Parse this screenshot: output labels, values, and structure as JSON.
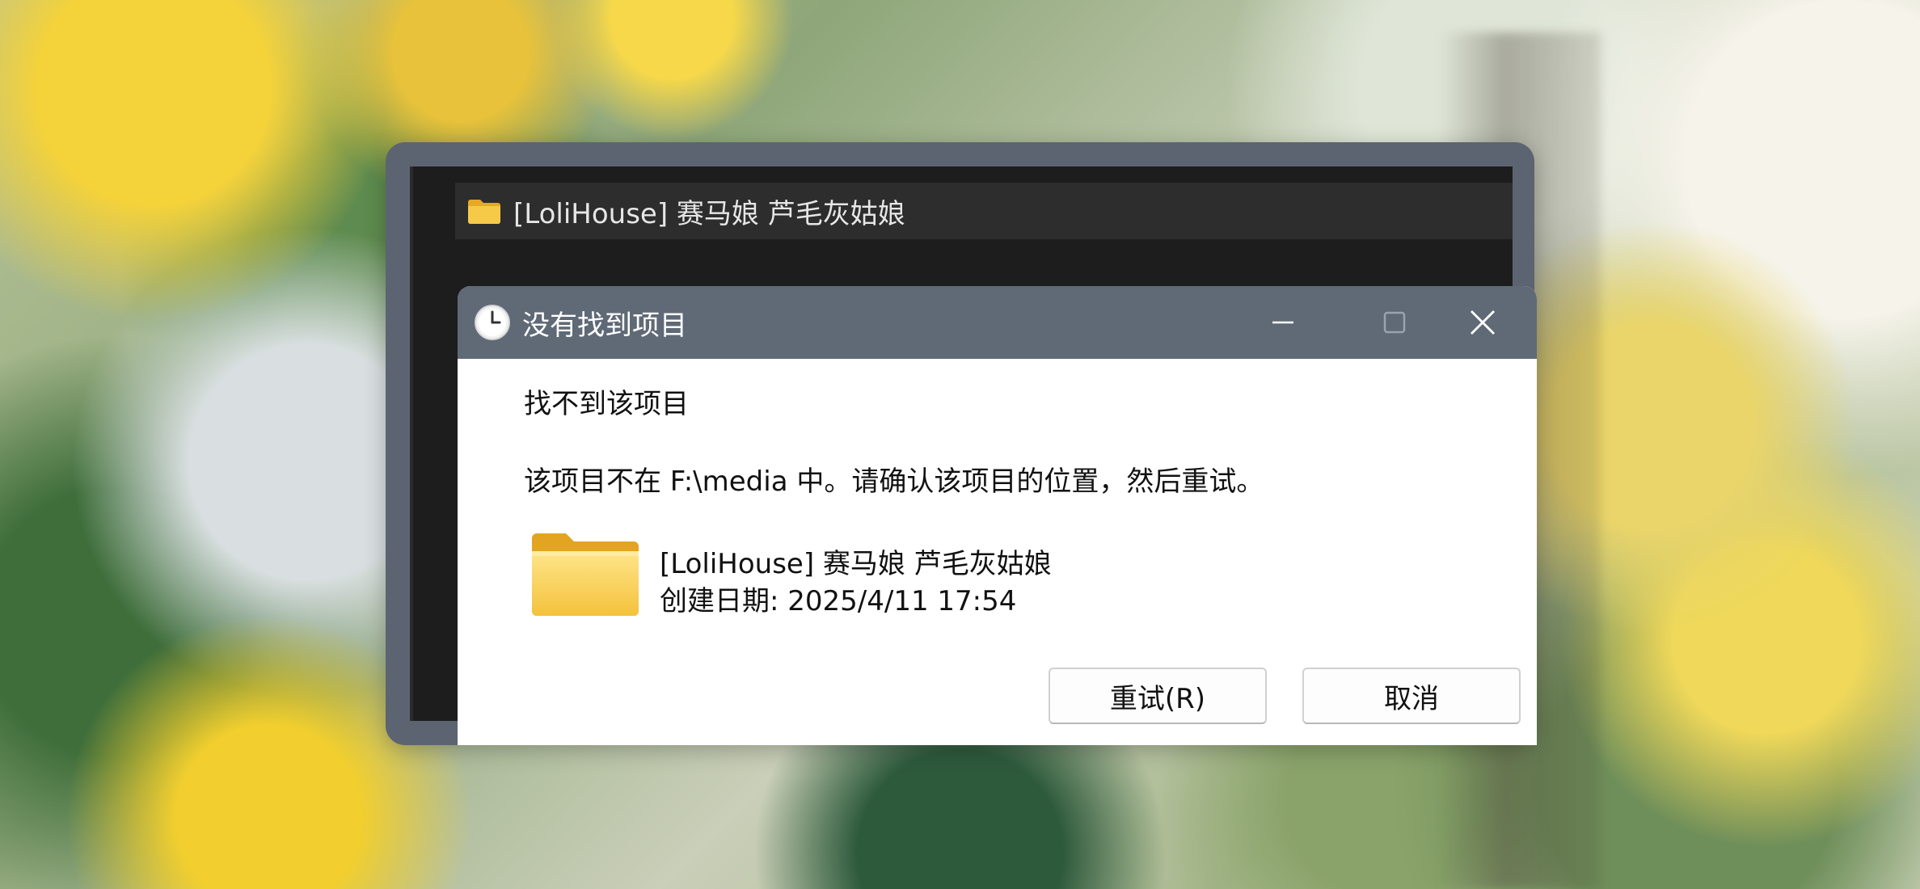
{
  "background": {
    "frame_color": "#5c6471",
    "titlebar_color": "#606a76"
  },
  "explorer": {
    "tab_title": "[LoliHouse] 赛马娘 芦毛灰姑娘",
    "tab_icon": "folder-icon"
  },
  "dialog": {
    "title": "没有找到项目",
    "title_icon": "clock-icon",
    "controls": {
      "minimize_icon": "minimize-icon",
      "maximize_icon": "maximize-icon",
      "close_icon": "close-icon"
    },
    "heading": "找不到该项目",
    "message": "该项目不在 F:\\media 中。请确认该项目的位置，然后重试。",
    "item": {
      "icon": "folder-icon",
      "name": "[LoliHouse] 赛马娘 芦毛灰姑娘",
      "date": "创建日期: 2025/4/11 17:54"
    },
    "buttons": {
      "retry": "重试(R)",
      "cancel": "取消"
    }
  }
}
